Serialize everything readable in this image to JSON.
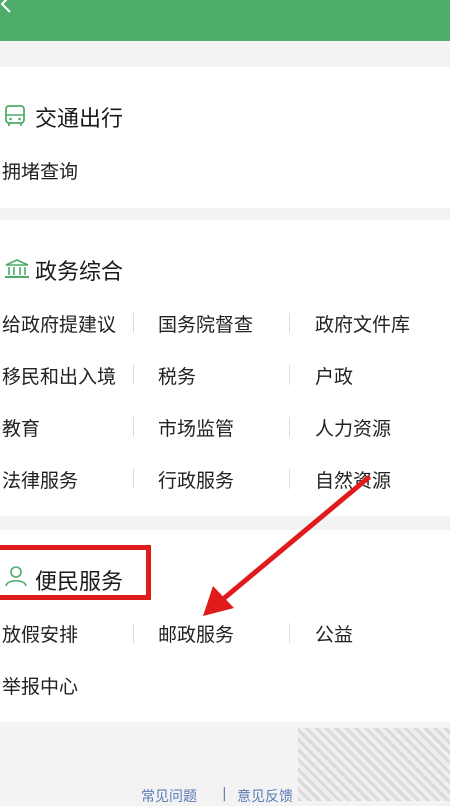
{
  "sections": [
    {
      "title": "交通出行",
      "icon": "bus-icon",
      "items": [
        "拥堵查询"
      ]
    },
    {
      "title": "政务综合",
      "icon": "government-building-icon",
      "items": [
        [
          "给政府提建议",
          "国务院督查",
          "政府文件库"
        ],
        [
          "移民和出入境",
          "税务",
          "户政"
        ],
        [
          "教育",
          "市场监管",
          "人力资源"
        ],
        [
          "法律服务",
          "行政服务",
          "自然资源"
        ]
      ]
    },
    {
      "title": "便民服务",
      "icon": "person-icon",
      "items": [
        [
          "放假安排",
          "邮政服务",
          "公益"
        ],
        [
          "举报中心"
        ]
      ]
    }
  ],
  "footer": {
    "faq": "常见问题",
    "separator": "|",
    "feedback": "意见反馈"
  },
  "colors": {
    "accent": "#4eac6a",
    "annotation": "#e01b1b"
  }
}
